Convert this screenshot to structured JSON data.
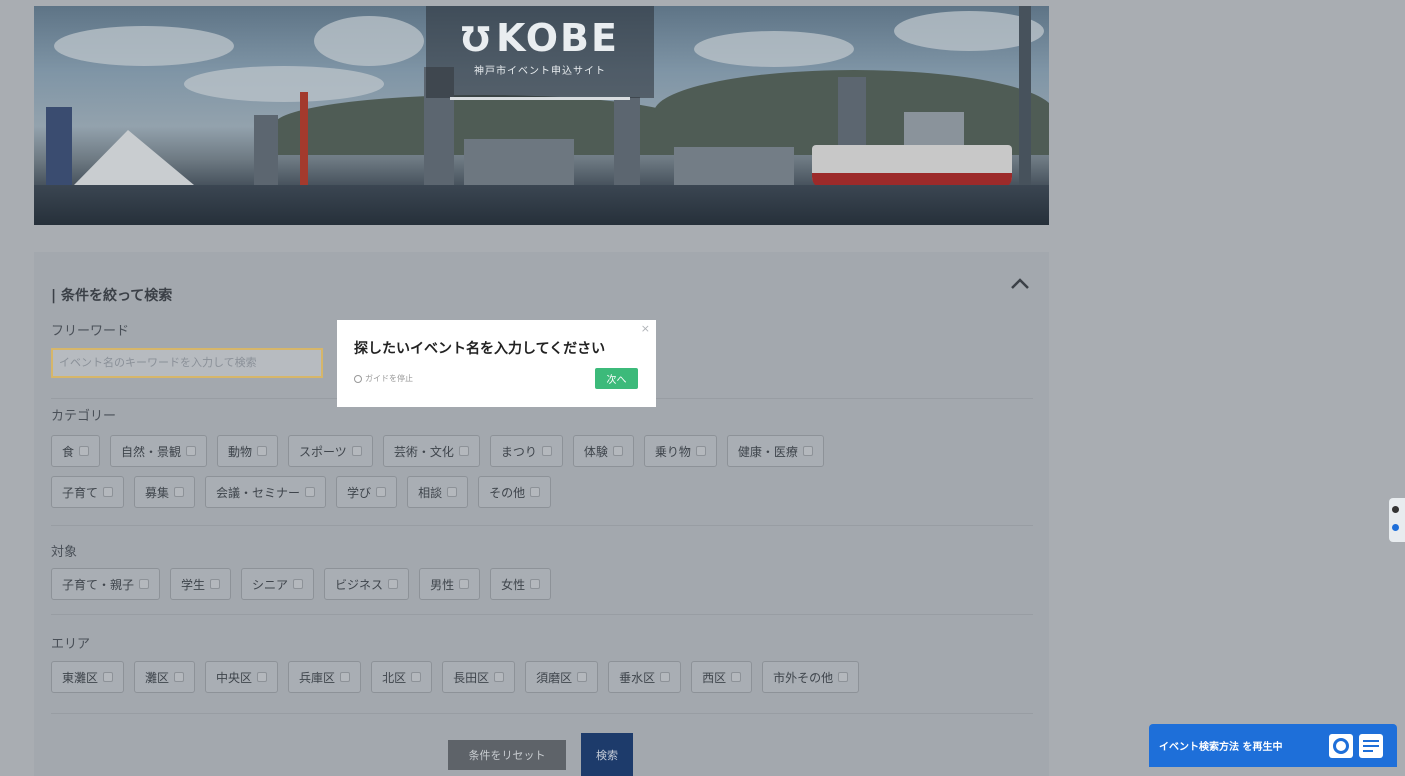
{
  "hero": {
    "logo_title": "KOBE",
    "logo_subtitle": "神戸市イベント申込サイト"
  },
  "search": {
    "title": "| 条件を絞って検索",
    "keyword_label": "フリーワード",
    "keyword_placeholder": "イベント名のキーワードを入力して検索",
    "category_label": "カテゴリー",
    "categories_row1": [
      "食",
      "自然・景観",
      "動物",
      "スポーツ",
      "芸術・文化",
      "まつり",
      "体験",
      "乗り物",
      "健康・医療"
    ],
    "categories_row2": [
      "子育て",
      "募集",
      "会議・セミナー",
      "学び",
      "相談",
      "その他"
    ],
    "target_label": "対象",
    "targets": [
      "子育て・親子",
      "学生",
      "シニア",
      "ビジネス",
      "男性",
      "女性"
    ],
    "area_label": "エリア",
    "areas": [
      "東灘区",
      "灘区",
      "中央区",
      "兵庫区",
      "北区",
      "長田区",
      "須磨区",
      "垂水区",
      "西区",
      "市外その他"
    ],
    "reset_label": "条件をリセット",
    "search_label": "検索"
  },
  "tooltip": {
    "title": "探したいイベント名を入力してください",
    "stop_label": "ガイドを停止",
    "next_label": "次へ",
    "close": "×"
  },
  "guide_bar": {
    "label": "イベント検索方法 を再生中"
  }
}
